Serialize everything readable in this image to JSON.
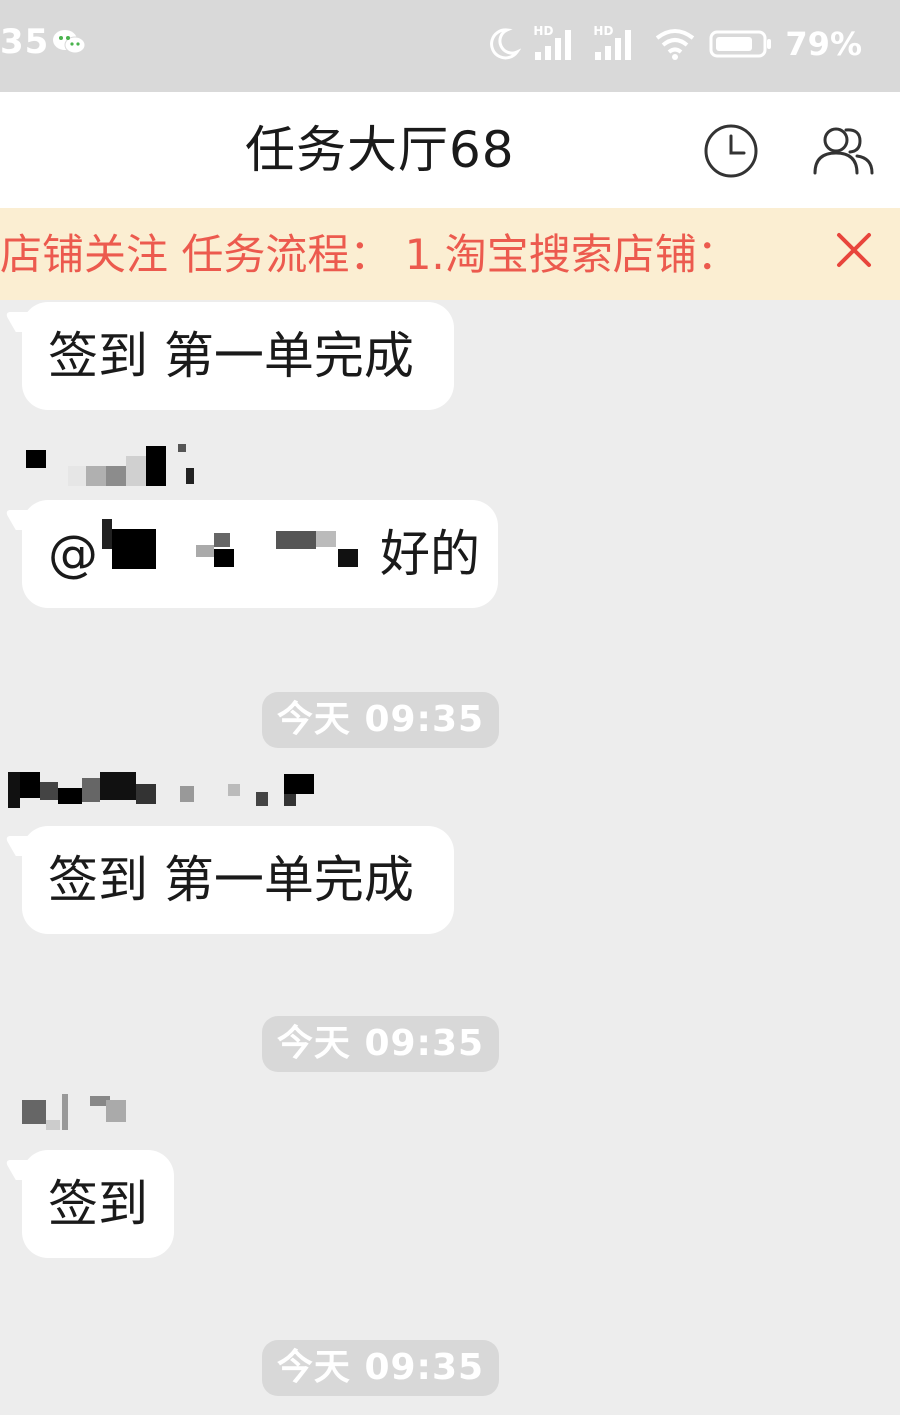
{
  "status_bar": {
    "time": "35",
    "network_badges": [
      "HD",
      "HD"
    ],
    "battery": "79%"
  },
  "header": {
    "title": "任务大厅68"
  },
  "notice": {
    "text": "店铺关注 任务流程： 1.淘宝搜索店铺："
  },
  "messages": [
    {
      "type": "bubble",
      "text": "签到 第一单完成"
    },
    {
      "type": "bubble",
      "mention_prefix": "@",
      "text": "好的"
    },
    {
      "type": "timestamp",
      "text": "今天 09:35"
    },
    {
      "type": "bubble",
      "text": "签到 第一单完成"
    },
    {
      "type": "timestamp",
      "text": "今天 09:35"
    },
    {
      "type": "bubble",
      "text": "签到"
    },
    {
      "type": "timestamp",
      "text": "今天 09:35"
    }
  ],
  "colors": {
    "notice_bg": "#fbeed2",
    "notice_text": "#ec5a4e",
    "chat_bg": "#ededed",
    "bubble_bg": "#ffffff",
    "timestamp_bg": "#d8d8d8"
  },
  "icons": {
    "history": "clock-icon",
    "members": "group-members-icon",
    "close": "close-icon",
    "wechat": "wechat-notification-icon"
  }
}
